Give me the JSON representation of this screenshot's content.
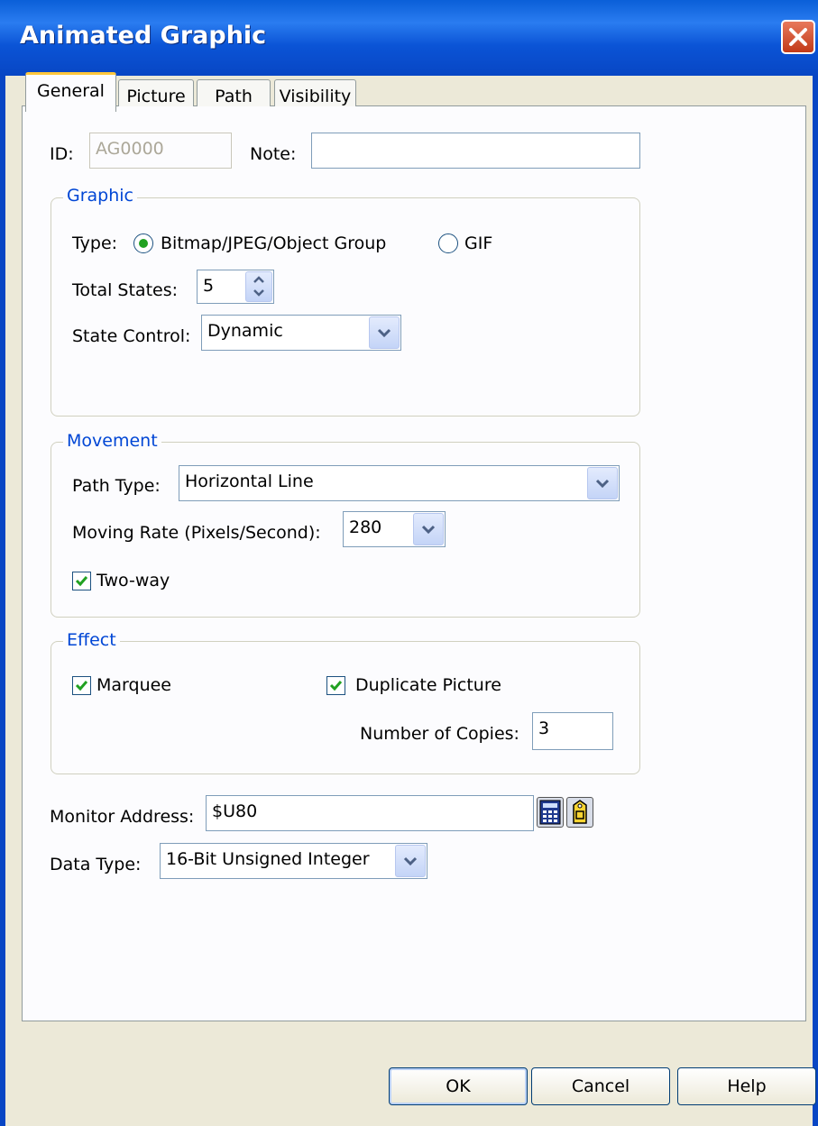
{
  "window": {
    "title": "Animated Graphic"
  },
  "tabs": [
    {
      "label": "General",
      "active": true
    },
    {
      "label": "Picture"
    },
    {
      "label": "Path"
    },
    {
      "label": "Visibility"
    }
  ],
  "general": {
    "id_label": "ID:",
    "id_value": "AG0000",
    "note_label": "Note:",
    "note_value": ""
  },
  "graphic": {
    "legend": "Graphic",
    "type_label": "Type:",
    "type_options": [
      "Bitmap/JPEG/Object Group",
      "GIF"
    ],
    "type_selected": "Bitmap/JPEG/Object Group",
    "total_states_label": "Total States:",
    "total_states_value": "5",
    "state_control_label": "State Control:",
    "state_control_value": "Dynamic"
  },
  "movement": {
    "legend": "Movement",
    "path_type_label": "Path Type:",
    "path_type_value": "Horizontal Line",
    "moving_rate_label": "Moving Rate (Pixels/Second):",
    "moving_rate_value": "280",
    "two_way_label": "Two-way",
    "two_way_checked": true
  },
  "effect": {
    "legend": "Effect",
    "marquee_label": "Marquee",
    "marquee_checked": true,
    "duplicate_label": "Duplicate Picture",
    "duplicate_checked": true,
    "copies_label": "Number of Copies:",
    "copies_value": "3"
  },
  "monitor": {
    "address_label": "Monitor Address:",
    "address_value": "$U80",
    "data_type_label": "Data Type:",
    "data_type_value": "16-Bit Unsigned Integer"
  },
  "buttons": {
    "ok": "OK",
    "cancel": "Cancel",
    "help": "Help"
  },
  "colors": {
    "title_bar": "#0a5fd8",
    "group_legend": "#0046d5",
    "check": "#21a121",
    "close": "#d6502b"
  },
  "icons": [
    "close-icon",
    "chevron-down-icon",
    "spin-up-icon",
    "spin-down-icon",
    "calculator-icon",
    "tag-icon",
    "checkmark-icon"
  ]
}
